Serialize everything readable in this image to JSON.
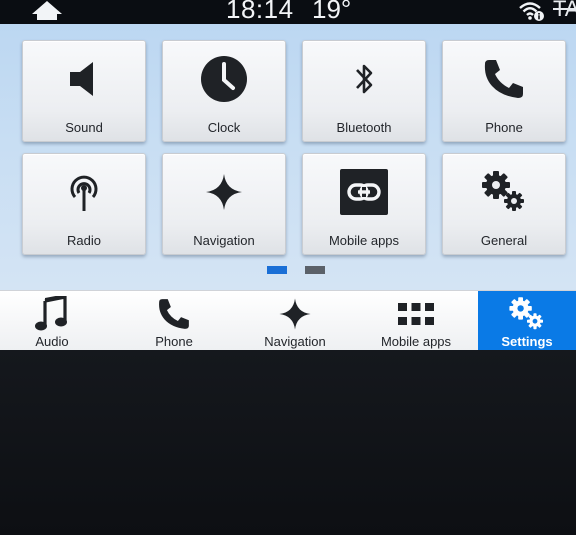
{
  "status": {
    "time": "18:14",
    "temperature": "19°",
    "traffic_announcement": "TA",
    "home_icon": "home-icon",
    "wifi_icon": "wifi-info-icon"
  },
  "tiles": [
    {
      "label": "Sound",
      "icon": "speaker-icon"
    },
    {
      "label": "Clock",
      "icon": "clock-icon"
    },
    {
      "label": "Bluetooth",
      "icon": "bluetooth-icon"
    },
    {
      "label": "Phone",
      "icon": "phone-icon"
    },
    {
      "label": "Radio",
      "icon": "radio-antenna-icon"
    },
    {
      "label": "Navigation",
      "icon": "navigation-star-icon"
    },
    {
      "label": "Mobile apps",
      "icon": "link-icon"
    },
    {
      "label": "General",
      "icon": "gears-icon"
    }
  ],
  "pager": {
    "pages": 2,
    "current": 1
  },
  "bottom_bar": [
    {
      "label": "Audio",
      "icon": "music-note-icon"
    },
    {
      "label": "Phone",
      "icon": "phone-icon"
    },
    {
      "label": "Navigation",
      "icon": "navigation-star-icon"
    },
    {
      "label": "Mobile apps",
      "icon": "app-grid-icon"
    },
    {
      "label": "Settings",
      "icon": "gears-icon",
      "active": true
    }
  ],
  "colors": {
    "active_tab": "#0a7ae6",
    "screen_bg": "#c8def3",
    "pager_active": "#1a6fd6",
    "pager_inactive": "#5b6169"
  }
}
